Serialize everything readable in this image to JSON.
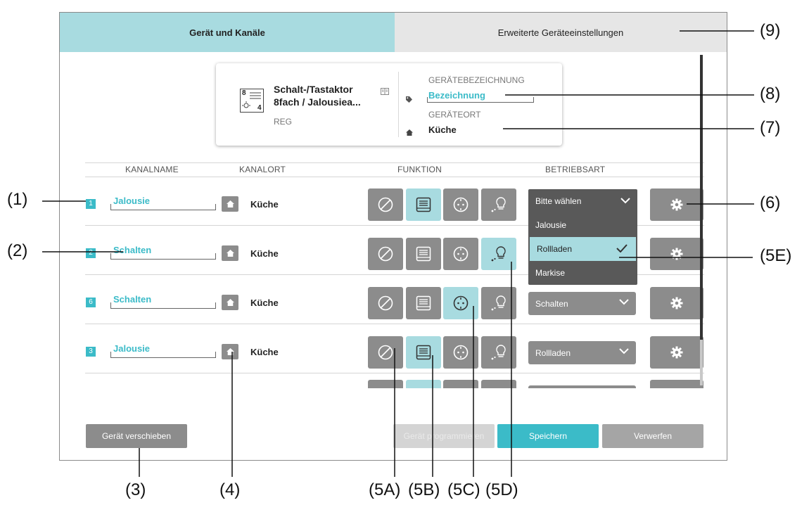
{
  "tabs": [
    {
      "label": "Gerät und Kanäle",
      "active": true
    },
    {
      "label": "Erweiterte Geräteeinstellungen",
      "active": false
    }
  ],
  "device": {
    "name_line1": "Schalt-/Tastaktor",
    "name_line2": "8fach / Jalousiea...",
    "type": "REG",
    "icon_numbers": [
      "8",
      "4"
    ],
    "designation_label": "GERÄTEBEZEICHNUNG",
    "designation_value": "Bezeichnung",
    "location_label": "GERÄTEORT",
    "location_value": "Küche"
  },
  "columns": {
    "name": "KANALNAME",
    "location": "KANALORT",
    "function": "FUNKTION",
    "mode": "BETRIEBSART"
  },
  "channels": [
    {
      "number": "1",
      "name": "Jalousie",
      "location": "Küche",
      "active_function": "jalousie",
      "mode": "Bitte wählen"
    },
    {
      "number": "2",
      "name": "Schalten",
      "location": "Küche",
      "active_function": "licht",
      "mode": ""
    },
    {
      "number": "6",
      "name": "Schalten",
      "location": "Küche",
      "active_function": "steckdose",
      "mode": "Schalten"
    },
    {
      "number": "3",
      "name": "Jalousie",
      "location": "Küche",
      "active_function": "jalousie",
      "mode": "Rollladen"
    }
  ],
  "dropdown": {
    "selected": "Bitte wählen",
    "options": [
      "Jalousie",
      "Rollladen",
      "Markise"
    ],
    "highlighted": "Rollladen"
  },
  "buttons": {
    "move_device": "Gerät verschieben",
    "program_device": "Gerät programmieren",
    "save": "Speichern",
    "discard": "Verwerfen"
  },
  "callouts": {
    "c1": "(1)",
    "c2": "(2)",
    "c3": "(3)",
    "c4": "(4)",
    "c5a": "(5A)",
    "c5b": "(5B)",
    "c5c": "(5C)",
    "c5d": "(5D)",
    "c5e": "(5E)",
    "c6": "(6)",
    "c7": "(7)",
    "c8": "(8)",
    "c9": "(9)"
  },
  "colors": {
    "accent": "#3bbbc8",
    "active_button": "#a8dbe0",
    "button_gray": "#8c8c8c",
    "dropdown_bg": "#595959"
  }
}
